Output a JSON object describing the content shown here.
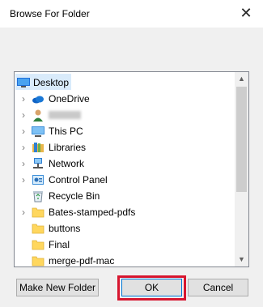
{
  "dialog": {
    "title": "Browse For Folder",
    "close_label": "✕"
  },
  "tree": {
    "items": [
      {
        "label": "Desktop",
        "icon": "desktop-icon",
        "expander": ""
      },
      {
        "label": "OneDrive",
        "icon": "cloud-icon",
        "expander": "›"
      },
      {
        "label": "",
        "icon": "user-icon",
        "expander": "›"
      },
      {
        "label": "This PC",
        "icon": "pc-icon",
        "expander": "›"
      },
      {
        "label": "Libraries",
        "icon": "library-icon",
        "expander": "›"
      },
      {
        "label": "Network",
        "icon": "network-icon",
        "expander": "›"
      },
      {
        "label": "Control Panel",
        "icon": "control-panel-icon",
        "expander": "›"
      },
      {
        "label": "Recycle Bin",
        "icon": "recycle-bin-icon",
        "expander": ""
      },
      {
        "label": "Bates-stamped-pdfs",
        "icon": "folder-icon",
        "expander": "›"
      },
      {
        "label": "buttons",
        "icon": "folder-icon",
        "expander": ""
      },
      {
        "label": "Final",
        "icon": "folder-icon",
        "expander": ""
      },
      {
        "label": "merge-pdf-mac",
        "icon": "folder-icon",
        "expander": ""
      }
    ],
    "scroll_up": "▲",
    "scroll_down": "▼"
  },
  "buttons": {
    "make_new_folder": "Make New Folder",
    "ok": "OK",
    "cancel": "Cancel"
  },
  "colors": {
    "selection": "#cce8ff",
    "highlight_border": "#d7162f",
    "folder": "#ffd75e"
  }
}
